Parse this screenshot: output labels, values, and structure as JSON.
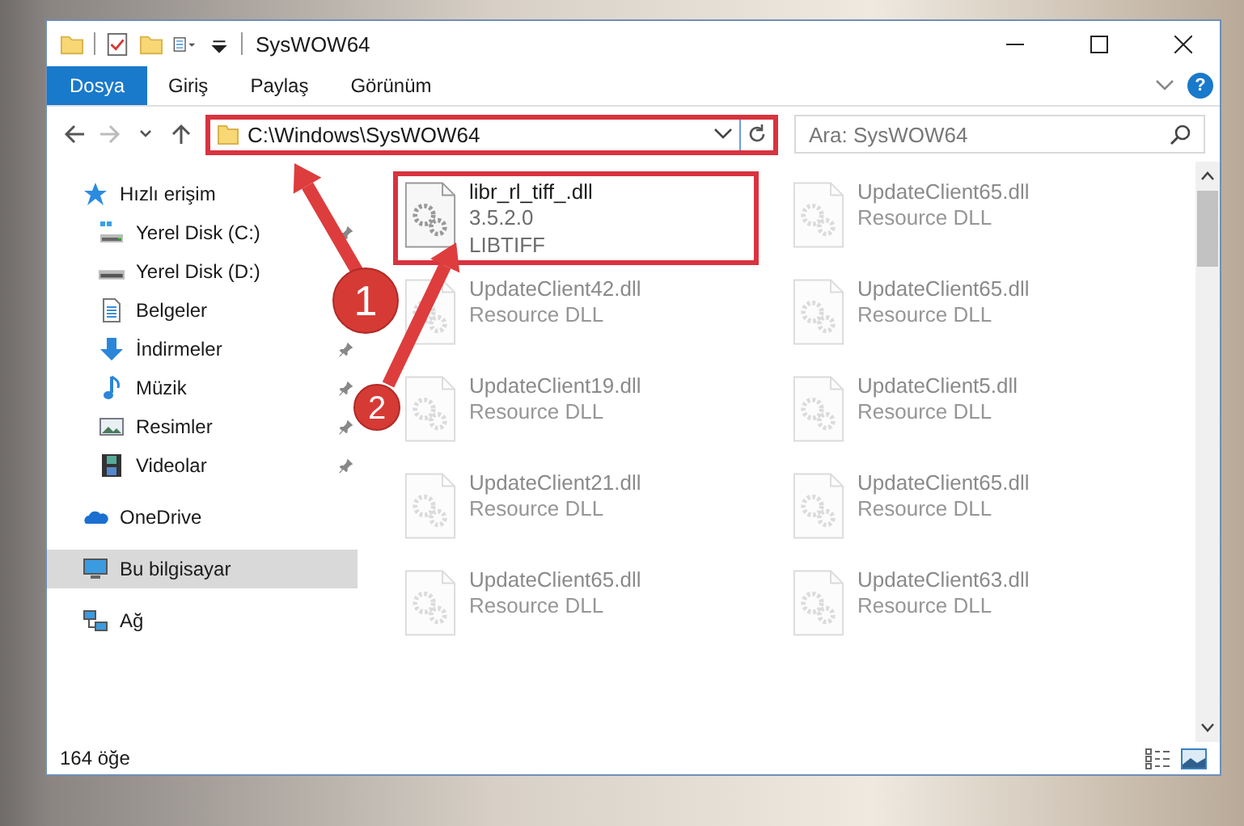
{
  "window": {
    "title": "SysWOW64"
  },
  "ribbon": {
    "tabs": [
      {
        "label": "Dosya",
        "selected": true
      },
      {
        "label": "Giriş",
        "selected": false
      },
      {
        "label": "Paylaş",
        "selected": false
      },
      {
        "label": "Görünüm",
        "selected": false
      }
    ],
    "help": "?"
  },
  "navigation": {
    "back": {
      "disabled": false
    },
    "forward": {
      "disabled": true
    }
  },
  "address_bar": {
    "path": "C:\\Windows\\SysWOW64",
    "highlighted": true
  },
  "search": {
    "placeholder": "Ara: SysWOW64"
  },
  "sidebar": {
    "items": [
      {
        "label": "Hızlı erişim",
        "kind": "quick-access",
        "selected": false,
        "children": [
          {
            "label": "Yerel Disk (C:)",
            "kind": "system-drive",
            "pinned": true,
            "selected": false
          },
          {
            "label": "Yerel Disk (D:)",
            "kind": "drive",
            "selected": false
          },
          {
            "label": "Belgeler",
            "kind": "documents",
            "selected": false
          },
          {
            "label": "İndirmeler",
            "kind": "downloads",
            "pinned": true,
            "selected": false
          },
          {
            "label": "Müzik",
            "kind": "music",
            "pinned": true,
            "selected": false
          },
          {
            "label": "Resimler",
            "kind": "pictures",
            "pinned": true,
            "selected": false
          },
          {
            "label": "Videolar",
            "kind": "videos",
            "pinned": true,
            "selected": false
          }
        ]
      },
      {
        "label": "OneDrive",
        "kind": "cloud",
        "selected": false
      },
      {
        "label": "Bu bilgisayar",
        "kind": "computer",
        "selected": true
      },
      {
        "label": "Ağ",
        "kind": "network",
        "selected": false
      }
    ]
  },
  "files": [
    {
      "name": "libr_rl_tiff_.dll",
      "details": [
        "3.5.2.0",
        "LIBTIFF"
      ],
      "highlighted": true,
      "faded": false
    },
    {
      "name": "UpdateClient65.dll",
      "details": [
        "Resource DLL"
      ],
      "highlighted": false,
      "faded": true
    },
    {
      "name": "UpdateClient42.dll",
      "details": [
        "Resource DLL"
      ],
      "highlighted": false,
      "faded": true
    },
    {
      "name": "UpdateClient65.dll",
      "details": [
        "Resource DLL"
      ],
      "highlighted": false,
      "faded": true
    },
    {
      "name": "UpdateClient19.dll",
      "details": [
        "Resource DLL"
      ],
      "highlighted": false,
      "faded": true
    },
    {
      "name": "UpdateClient5.dll",
      "details": [
        "Resource DLL"
      ],
      "highlighted": false,
      "faded": true
    },
    {
      "name": "UpdateClient21.dll",
      "details": [
        "Resource DLL"
      ],
      "highlighted": false,
      "faded": true
    },
    {
      "name": "UpdateClient65.dll",
      "details": [
        "Resource DLL"
      ],
      "highlighted": false,
      "faded": true
    },
    {
      "name": "UpdateClient65.dll",
      "details": [
        "Resource DLL"
      ],
      "highlighted": false,
      "faded": true
    },
    {
      "name": "UpdateClient63.dll",
      "details": [
        "Resource DLL"
      ],
      "highlighted": false,
      "faded": true
    }
  ],
  "status_bar": {
    "count": "164 öğe"
  },
  "annotations": [
    {
      "label": "1"
    },
    {
      "label": "2"
    }
  ]
}
